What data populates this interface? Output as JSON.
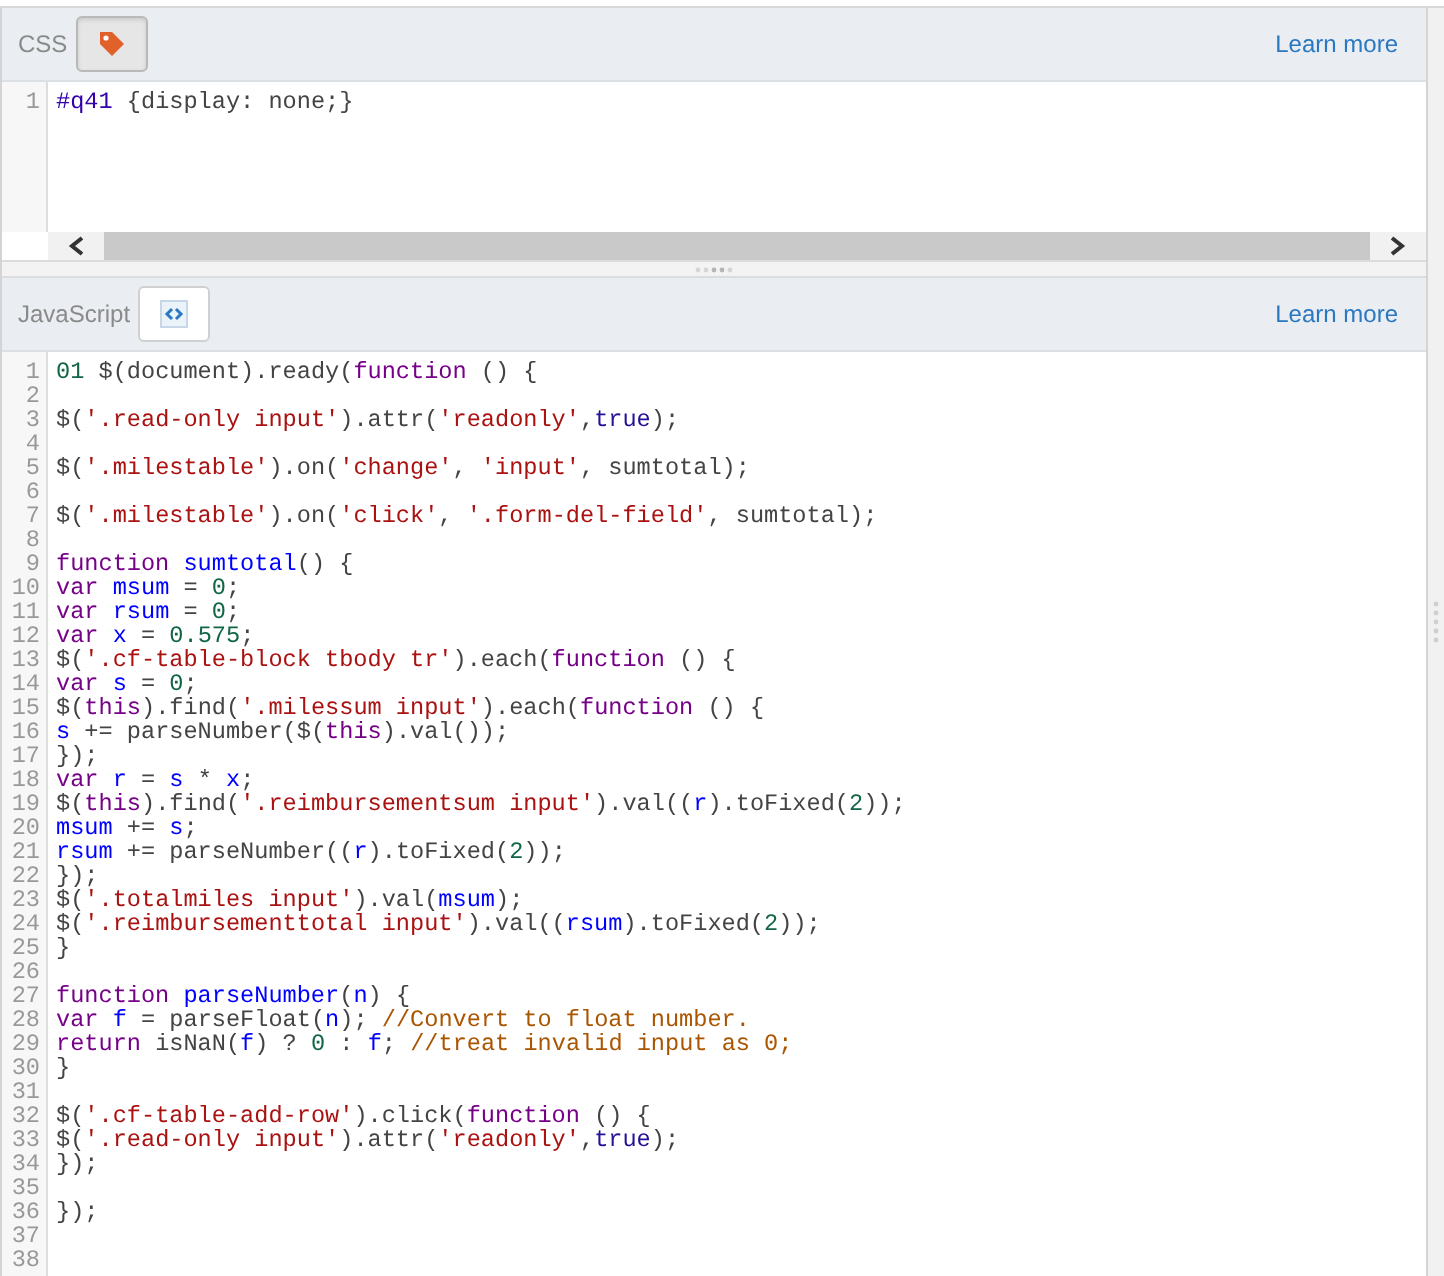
{
  "panels": [
    {
      "kind": "css",
      "label": "CSS",
      "selected": true,
      "link": "Learn more",
      "scrollbar": true,
      "lines": [
        {
          "number": "1",
          "tokens": [
            {
              "kind": "builtin",
              "text": "#q41"
            },
            {
              "kind": "plain",
              "text": " {display: none;}"
            }
          ]
        }
      ]
    },
    {
      "kind": "js",
      "label": "JavaScript",
      "selected": false,
      "link": "Learn more",
      "scrollbar": false,
      "lines": [
        {
          "number": "1",
          "tokens": [
            {
              "kind": "num",
              "text": "01"
            },
            {
              "kind": "plain",
              "text": " $(document).ready("
            },
            {
              "kind": "kw",
              "text": "function"
            },
            {
              "kind": "plain",
              "text": " () {"
            }
          ]
        },
        {
          "number": "2"
        },
        {
          "number": "3",
          "tokens": [
            {
              "kind": "plain",
              "text": "$("
            },
            {
              "kind": "str",
              "text": "'.read-only input'"
            },
            {
              "kind": "plain",
              "text": ").attr("
            },
            {
              "kind": "str",
              "text": "'readonly'"
            },
            {
              "kind": "plain",
              "text": ","
            },
            {
              "kind": "atom",
              "text": "true"
            },
            {
              "kind": "plain",
              "text": ");"
            }
          ]
        },
        {
          "number": "4"
        },
        {
          "number": "5",
          "tokens": [
            {
              "kind": "plain",
              "text": "$("
            },
            {
              "kind": "str",
              "text": "'.milestable'"
            },
            {
              "kind": "plain",
              "text": ").on("
            },
            {
              "kind": "str",
              "text": "'change'"
            },
            {
              "kind": "plain",
              "text": ", "
            },
            {
              "kind": "str",
              "text": "'input'"
            },
            {
              "kind": "plain",
              "text": ", sumtotal);"
            }
          ]
        },
        {
          "number": "6"
        },
        {
          "number": "7",
          "tokens": [
            {
              "kind": "plain",
              "text": "$("
            },
            {
              "kind": "str",
              "text": "'.milestable'"
            },
            {
              "kind": "plain",
              "text": ").on("
            },
            {
              "kind": "str",
              "text": "'click'"
            },
            {
              "kind": "plain",
              "text": ", "
            },
            {
              "kind": "str",
              "text": "'.form-del-field'"
            },
            {
              "kind": "plain",
              "text": ", sumtotal);"
            }
          ]
        },
        {
          "number": "8"
        },
        {
          "number": "9",
          "tokens": [
            {
              "kind": "kw",
              "text": "function "
            },
            {
              "kind": "def",
              "text": "sumtotal"
            },
            {
              "kind": "plain",
              "text": "() {"
            }
          ]
        },
        {
          "number": "10",
          "tokens": [
            {
              "kind": "kw",
              "text": "var "
            },
            {
              "kind": "def",
              "text": "msum"
            },
            {
              "kind": "plain",
              "text": " = "
            },
            {
              "kind": "num",
              "text": "0"
            },
            {
              "kind": "plain",
              "text": ";"
            }
          ]
        },
        {
          "number": "11",
          "tokens": [
            {
              "kind": "kw",
              "text": "var "
            },
            {
              "kind": "def",
              "text": "rsum"
            },
            {
              "kind": "plain",
              "text": " = "
            },
            {
              "kind": "num",
              "text": "0"
            },
            {
              "kind": "plain",
              "text": ";"
            }
          ]
        },
        {
          "number": "12",
          "tokens": [
            {
              "kind": "kw",
              "text": "var "
            },
            {
              "kind": "def",
              "text": "x"
            },
            {
              "kind": "plain",
              "text": " = "
            },
            {
              "kind": "num",
              "text": "0.575"
            },
            {
              "kind": "plain",
              "text": ";"
            }
          ]
        },
        {
          "number": "13",
          "tokens": [
            {
              "kind": "plain",
              "text": "$("
            },
            {
              "kind": "str",
              "text": "'.cf-table-block tbody tr'"
            },
            {
              "kind": "plain",
              "text": ").each("
            },
            {
              "kind": "kw",
              "text": "function"
            },
            {
              "kind": "plain",
              "text": " () {"
            }
          ]
        },
        {
          "number": "14",
          "tokens": [
            {
              "kind": "kw",
              "text": "var "
            },
            {
              "kind": "def",
              "text": "s"
            },
            {
              "kind": "plain",
              "text": " = "
            },
            {
              "kind": "num",
              "text": "0"
            },
            {
              "kind": "plain",
              "text": ";"
            }
          ]
        },
        {
          "number": "15",
          "tokens": [
            {
              "kind": "plain",
              "text": "$("
            },
            {
              "kind": "kw",
              "text": "this"
            },
            {
              "kind": "plain",
              "text": ").find("
            },
            {
              "kind": "str",
              "text": "'.milessum input'"
            },
            {
              "kind": "plain",
              "text": ").each("
            },
            {
              "kind": "kw",
              "text": "function"
            },
            {
              "kind": "plain",
              "text": " () {"
            }
          ]
        },
        {
          "number": "16",
          "tokens": [
            {
              "kind": "def",
              "text": "s"
            },
            {
              "kind": "plain",
              "text": " += parseNumber($("
            },
            {
              "kind": "kw",
              "text": "this"
            },
            {
              "kind": "plain",
              "text": ").val());"
            }
          ]
        },
        {
          "number": "17",
          "tokens": [
            {
              "kind": "plain",
              "text": "});"
            }
          ]
        },
        {
          "number": "18",
          "tokens": [
            {
              "kind": "kw",
              "text": "var "
            },
            {
              "kind": "def",
              "text": "r"
            },
            {
              "kind": "plain",
              "text": " = "
            },
            {
              "kind": "def",
              "text": "s"
            },
            {
              "kind": "plain",
              "text": " * "
            },
            {
              "kind": "def",
              "text": "x"
            },
            {
              "kind": "plain",
              "text": ";"
            }
          ]
        },
        {
          "number": "19",
          "tokens": [
            {
              "kind": "plain",
              "text": "$("
            },
            {
              "kind": "kw",
              "text": "this"
            },
            {
              "kind": "plain",
              "text": ").find("
            },
            {
              "kind": "str",
              "text": "'.reimbursementsum input'"
            },
            {
              "kind": "plain",
              "text": ").val(("
            },
            {
              "kind": "def",
              "text": "r"
            },
            {
              "kind": "plain",
              "text": ").toFixed("
            },
            {
              "kind": "num",
              "text": "2"
            },
            {
              "kind": "plain",
              "text": "));"
            }
          ]
        },
        {
          "number": "20",
          "tokens": [
            {
              "kind": "def",
              "text": "msum"
            },
            {
              "kind": "plain",
              "text": " += "
            },
            {
              "kind": "def",
              "text": "s"
            },
            {
              "kind": "plain",
              "text": ";"
            }
          ]
        },
        {
          "number": "21",
          "tokens": [
            {
              "kind": "def",
              "text": "rsum"
            },
            {
              "kind": "plain",
              "text": " += parseNumber(("
            },
            {
              "kind": "def",
              "text": "r"
            },
            {
              "kind": "plain",
              "text": ").toFixed("
            },
            {
              "kind": "num",
              "text": "2"
            },
            {
              "kind": "plain",
              "text": "));"
            }
          ]
        },
        {
          "number": "22",
          "tokens": [
            {
              "kind": "plain",
              "text": "});"
            }
          ]
        },
        {
          "number": "23",
          "tokens": [
            {
              "kind": "plain",
              "text": "$("
            },
            {
              "kind": "str",
              "text": "'.totalmiles input'"
            },
            {
              "kind": "plain",
              "text": ").val("
            },
            {
              "kind": "def",
              "text": "msum"
            },
            {
              "kind": "plain",
              "text": ");"
            }
          ]
        },
        {
          "number": "24",
          "tokens": [
            {
              "kind": "plain",
              "text": "$("
            },
            {
              "kind": "str",
              "text": "'.reimbursementtotal input'"
            },
            {
              "kind": "plain",
              "text": ").val(("
            },
            {
              "kind": "def",
              "text": "rsum"
            },
            {
              "kind": "plain",
              "text": ").toFixed("
            },
            {
              "kind": "num",
              "text": "2"
            },
            {
              "kind": "plain",
              "text": "));"
            }
          ]
        },
        {
          "number": "25",
          "tokens": [
            {
              "kind": "plain",
              "text": "}"
            }
          ]
        },
        {
          "number": "26"
        },
        {
          "number": "27",
          "tokens": [
            {
              "kind": "kw",
              "text": "function "
            },
            {
              "kind": "def",
              "text": "parseNumber"
            },
            {
              "kind": "plain",
              "text": "("
            },
            {
              "kind": "def",
              "text": "n"
            },
            {
              "kind": "plain",
              "text": ") {"
            }
          ]
        },
        {
          "number": "28",
          "tokens": [
            {
              "kind": "kw",
              "text": "var "
            },
            {
              "kind": "def",
              "text": "f"
            },
            {
              "kind": "plain",
              "text": " = parseFloat("
            },
            {
              "kind": "def",
              "text": "n"
            },
            {
              "kind": "plain",
              "text": "); "
            },
            {
              "kind": "com",
              "text": "//Convert to float number."
            }
          ]
        },
        {
          "number": "29",
          "tokens": [
            {
              "kind": "kw",
              "text": "return"
            },
            {
              "kind": "plain",
              "text": " isNaN("
            },
            {
              "kind": "def",
              "text": "f"
            },
            {
              "kind": "plain",
              "text": ") ? "
            },
            {
              "kind": "num",
              "text": "0"
            },
            {
              "kind": "plain",
              "text": " : "
            },
            {
              "kind": "def",
              "text": "f"
            },
            {
              "kind": "plain",
              "text": "; "
            },
            {
              "kind": "com",
              "text": "//treat invalid input as 0;"
            }
          ]
        },
        {
          "number": "30",
          "tokens": [
            {
              "kind": "plain",
              "text": "}"
            }
          ]
        },
        {
          "number": "31"
        },
        {
          "number": "32",
          "tokens": [
            {
              "kind": "plain",
              "text": "$("
            },
            {
              "kind": "str",
              "text": "'.cf-table-add-row'"
            },
            {
              "kind": "plain",
              "text": ").click("
            },
            {
              "kind": "kw",
              "text": "function"
            },
            {
              "kind": "plain",
              "text": " () {"
            }
          ]
        },
        {
          "number": "33",
          "tokens": [
            {
              "kind": "plain",
              "text": "$("
            },
            {
              "kind": "str",
              "text": "'.read-only input'"
            },
            {
              "kind": "plain",
              "text": ").attr("
            },
            {
              "kind": "str",
              "text": "'readonly'"
            },
            {
              "kind": "plain",
              "text": ","
            },
            {
              "kind": "atom",
              "text": "true"
            },
            {
              "kind": "plain",
              "text": ");"
            }
          ]
        },
        {
          "number": "34",
          "tokens": [
            {
              "kind": "plain",
              "text": "});"
            }
          ]
        },
        {
          "number": "35"
        },
        {
          "number": "36",
          "tokens": [
            {
              "kind": "plain",
              "text": "});"
            }
          ]
        },
        {
          "number": "37"
        },
        {
          "number": "38"
        }
      ]
    }
  ]
}
